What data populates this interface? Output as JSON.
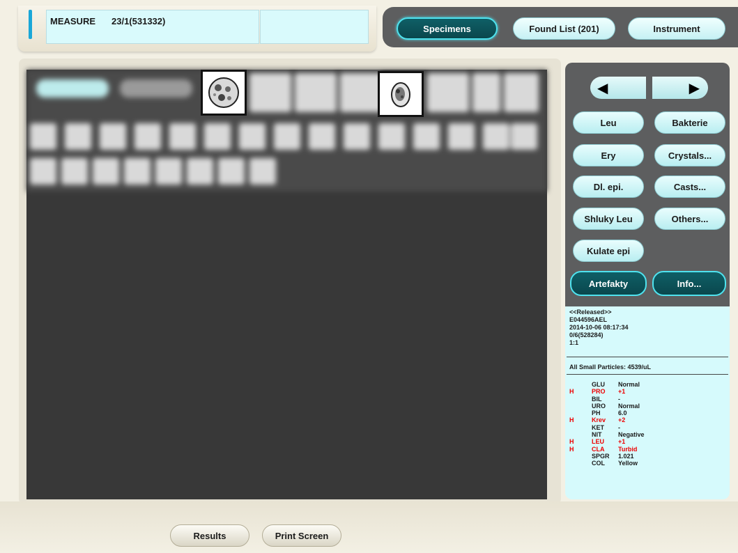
{
  "header": {
    "mode_label": "MEASURE",
    "rack_position": "23/1(531332)"
  },
  "nav": {
    "specimens": "Specimens",
    "found_list": "Found List (201)",
    "instrument": "Instrument"
  },
  "viewer": {
    "thumbnail_1": "cell-thumbnail",
    "thumbnail_2": "cell-thumbnail"
  },
  "side": {
    "prev_icon": "◀",
    "next_icon": "▶",
    "buttons": {
      "leu": "Leu",
      "bakterie": "Bakterie",
      "ery": "Ery",
      "crystals": "Crystals...",
      "dl_epi": "Dl. epi.",
      "casts": "Casts...",
      "shluky_leu": "Shluky Leu",
      "others": "Others...",
      "kulate_epi": "Kulate epi",
      "artefakty": "Artefakty",
      "info": "Info..."
    }
  },
  "info": {
    "status": "<<Released>>",
    "specimen_id": "E044596AEL",
    "datetime": "2014-10-06 08:17:34",
    "rack": "0/6(528284)",
    "dilution": "1:1",
    "small_particles": "All Small Particles: 4539/uL",
    "chemistry": [
      {
        "flag": "",
        "name": "GLU",
        "value": "Normal",
        "abnormal": false
      },
      {
        "flag": "H",
        "name": "PRO",
        "value": "+1",
        "abnormal": true
      },
      {
        "flag": "",
        "name": "BIL",
        "value": "-",
        "abnormal": false
      },
      {
        "flag": "",
        "name": "URO",
        "value": "Normal",
        "abnormal": false
      },
      {
        "flag": "",
        "name": "PH",
        "value": "6.0",
        "abnormal": false
      },
      {
        "flag": "H",
        "name": "Krev",
        "value": "+2",
        "abnormal": true
      },
      {
        "flag": "",
        "name": "KET",
        "value": "-",
        "abnormal": false
      },
      {
        "flag": "",
        "name": "NIT",
        "value": "Negative",
        "abnormal": false
      },
      {
        "flag": "H",
        "name": "LEU",
        "value": "+1",
        "abnormal": true
      },
      {
        "flag": "H",
        "name": "CLA",
        "value": "Turbid",
        "abnormal": true
      },
      {
        "flag": "",
        "name": "SPGR",
        "value": "1.021",
        "abnormal": false
      },
      {
        "flag": "",
        "name": "COL",
        "value": "Yellow",
        "abnormal": false
      }
    ]
  },
  "footer": {
    "results": "Results",
    "print_screen": "Print Screen"
  },
  "colors": {
    "accent": "#1aa7d8",
    "panel_dark": "#5d5e5f",
    "panel_light": "#d6fafc",
    "abnormal": "#ee0000"
  }
}
